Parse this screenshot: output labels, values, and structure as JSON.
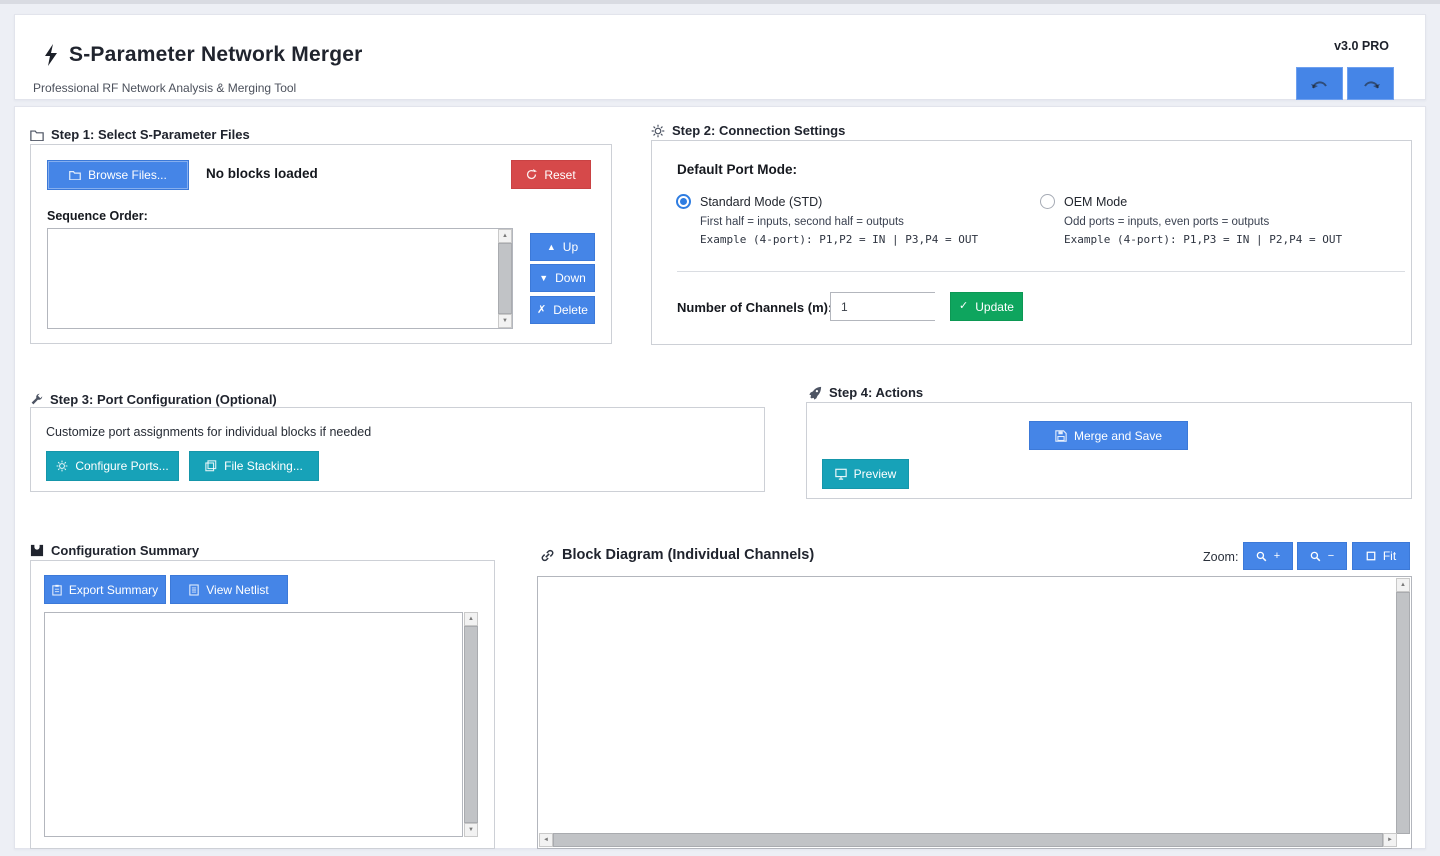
{
  "app": {
    "title": "S-Parameter Network Merger",
    "subtitle": "Professional RF Network Analysis & Merging Tool",
    "version": "v3.0 PRO"
  },
  "colors": {
    "primary_blue": "#4585e7",
    "danger_red": "#d6494a",
    "success_green": "#0ea55e",
    "info_teal": "#17a2b8",
    "page_background": "#edeff5"
  },
  "icons": {
    "up": "▲",
    "down": "▼",
    "delete": "✗",
    "check": "✓",
    "plus": "+",
    "minus": "−",
    "spin_up": "▲",
    "spin_down": "▼",
    "scroll_up": "▲",
    "scroll_down": "▼",
    "scroll_left": "◄",
    "scroll_right": "►"
  },
  "step1": {
    "title": "Step 1: Select S-Parameter Files",
    "browse_label": "Browse Files...",
    "status": "No blocks loaded",
    "reset_label": "Reset",
    "sequence_label": "Sequence Order:",
    "up_label": "Up",
    "down_label": "Down",
    "delete_label": "Delete",
    "sequence_items": []
  },
  "step2": {
    "title": "Step 2: Connection Settings",
    "port_mode_label": "Default Port Mode:",
    "modes": [
      {
        "label": "Standard Mode (STD)",
        "desc": "First half = inputs, second half = outputs",
        "example": "Example (4-port): P1,P2 = IN | P3,P4 = OUT",
        "selected": true
      },
      {
        "label": "OEM Mode",
        "desc": "Odd ports = inputs, even ports = outputs",
        "example": "Example (4-port): P1,P3 = IN | P2,P4 = OUT",
        "selected": false
      }
    ],
    "channels_label": "Number of Channels (m):",
    "channels_value": "1",
    "update_label": "Update"
  },
  "step3": {
    "title": "Step 3: Port Configuration (Optional)",
    "desc": "Customize port assignments for individual blocks if needed",
    "configure_ports_label": "Configure Ports...",
    "file_stacking_label": "File Stacking..."
  },
  "step4": {
    "title": "Step 4: Actions",
    "merge_save_label": "Merge and Save",
    "preview_label": "Preview"
  },
  "summary": {
    "title": "Configuration Summary",
    "export_label": "Export Summary",
    "netlist_label": "View Netlist",
    "content": ""
  },
  "diagram": {
    "title": "Block Diagram (Individual Channels)",
    "zoom_label": "Zoom:",
    "fit_label": "Fit"
  }
}
